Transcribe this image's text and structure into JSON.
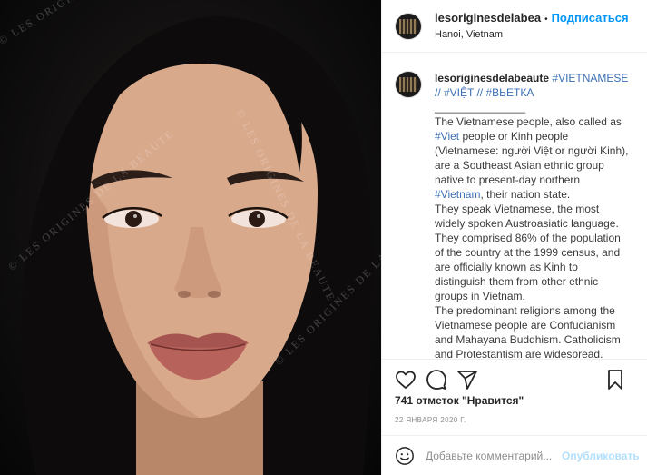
{
  "post": {
    "watermark_text": "© LES ORIGINES DE LA BEAUTE",
    "photo_description_icon": "portrait-photo"
  },
  "header": {
    "username": "lesoriginesdelabea",
    "dot": "•",
    "follow_label": "Подписаться",
    "location": "Hanoi, Vietnam"
  },
  "caption": {
    "username": "lesoriginesdelabeaute",
    "tags_line1": "#VIETNAMESE",
    "tags_line2_a": "// #VIỆT // #ВЬЕТКА",
    "separator": "_______________",
    "p1_a": "The Vietnamese people, also called as ",
    "p1_tag_viet": "#Viet",
    "p1_b": " people or Kinh people (Vietnamese: người Việt or người Kinh), are a Southeast Asian ethnic group native to present-day northern ",
    "p1_tag_vietnam": "#Vietnam",
    "p1_c": ", their nation state.",
    "p2": "They speak Vietnamese, the most widely spoken Austroasiatic language. They comprised 86% of the population of the country at the 1999 census, and are officially known as Kinh to distinguish them from other ethnic groups in Vietnam.",
    "p3": "The predominant religions among the Vietnamese people are Confucianism and Mahayana Buddhism. Catholicism and Protestantism are widespread."
  },
  "actions": {
    "like_icon": "heart-icon",
    "comment_icon": "comment-icon",
    "share_icon": "paper-plane-icon",
    "save_icon": "bookmark-icon"
  },
  "likes_text": "741 отметок \"Нравится\"",
  "date_text": "22 ЯНВАРЯ 2020 Г.",
  "comment": {
    "placeholder": "Добавьте комментарий...",
    "post_label": "Опубликовать",
    "emoji_icon": "smiley-icon"
  },
  "colors": {
    "accent": "#0095f6",
    "link": "#3b6fb6",
    "muted": "#8e8e8e",
    "post_disabled": "#b2dffc"
  }
}
